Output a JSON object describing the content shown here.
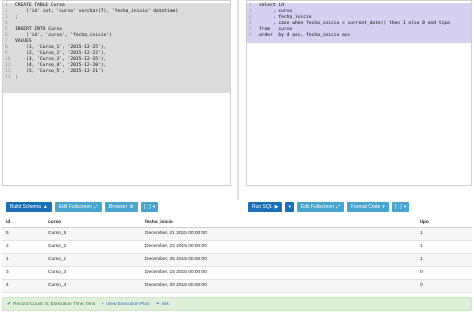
{
  "schema_editor": {
    "lines": [
      {
        "n": "1",
        "t": "CREATE TABLE Curso"
      },
      {
        "n": "2",
        "t": "    ('id' int, 'curso' varchar(7), 'fecha_inicio' datetime)"
      },
      {
        "n": "3",
        "t": ";"
      },
      {
        "n": "4",
        "t": ""
      },
      {
        "n": "5",
        "t": "INSERT INTO Curso"
      },
      {
        "n": "6",
        "t": "    ('id', 'curso', 'fecha_inicio')"
      },
      {
        "n": "7",
        "t": "VALUES"
      },
      {
        "n": "8",
        "t": "    (1, 'Curso_1', '2015-12-25'),"
      },
      {
        "n": "9",
        "t": "    (2, 'Curso_2', '2015-12-22'),"
      },
      {
        "n": "10",
        "t": "    (3, 'Curso_3', '2015-12-15'),"
      },
      {
        "n": "11",
        "t": "    (4, 'Curso_4', '2015-12-20'),"
      },
      {
        "n": "12",
        "t": "    (5, 'Curso_5', '2015-12-21')"
      },
      {
        "n": "13",
        "t": ";"
      }
    ]
  },
  "query_editor": {
    "lines": [
      {
        "n": "1",
        "t": "select id"
      },
      {
        "n": "2",
        "t": "     , curso"
      },
      {
        "n": "3",
        "t": "     , fecha_inicio"
      },
      {
        "n": "4",
        "t": "     , case when fecha_inicio < current_date() then 1 else 0 end tipo"
      },
      {
        "n": "5",
        "t": "from   curso"
      },
      {
        "n": "6",
        "t": "order  by 4 asc, fecha_inicio asc"
      }
    ]
  },
  "left_buttons": {
    "build_schema": "Build Schema",
    "edit_fullscreen": "Edit Fullscreen",
    "browser": "Browser",
    "extra": "[ ; ]"
  },
  "right_buttons": {
    "run_sql": "Run SQL",
    "edit_fullscreen": "Edit Fullscreen",
    "format_code": "Format Code",
    "extra": "[ ; ]"
  },
  "results": {
    "headers": [
      "id",
      "curso",
      "fecha_inicio",
      "tipo"
    ],
    "rows": [
      [
        "5",
        "Curso_5",
        "December, 21 2015 00:00:00",
        "1"
      ],
      [
        "2",
        "Curso_2",
        "December, 22 2015 00:00:00",
        "1"
      ],
      [
        "1",
        "Curso_1",
        "December, 25 2015 00:00:00",
        "1"
      ],
      [
        "3",
        "Curso_3",
        "December, 15 2015 00:00:00",
        "0"
      ],
      [
        "4",
        "Curso_4",
        "December, 20 2015 00:00:00",
        "0"
      ]
    ]
  },
  "status": {
    "summary": "Record Count: 5; Execution Time: 0ms",
    "execution_plan": "View Execution Plan",
    "link": "link"
  },
  "colors": {
    "primary_button": "#1a70b8",
    "secondary_button": "#47a4cf",
    "status_bg": "#dff0d8",
    "query_highlight": "#d6d1f0"
  }
}
